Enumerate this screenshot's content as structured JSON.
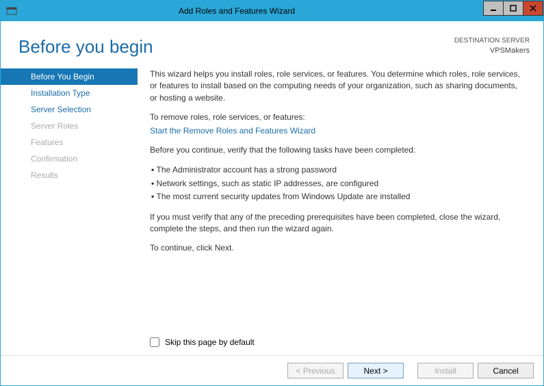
{
  "titlebar": {
    "title": "Add Roles and Features Wizard"
  },
  "header": {
    "title": "Before you begin",
    "dest_label": "DESTINATION SERVER",
    "dest_server": "VPSMakers"
  },
  "sidebar": {
    "items": [
      {
        "label": "Before You Begin",
        "state": "active"
      },
      {
        "label": "Installation Type",
        "state": "enabled"
      },
      {
        "label": "Server Selection",
        "state": "enabled"
      },
      {
        "label": "Server Roles",
        "state": "disabled"
      },
      {
        "label": "Features",
        "state": "disabled"
      },
      {
        "label": "Confirmation",
        "state": "disabled"
      },
      {
        "label": "Results",
        "state": "disabled"
      }
    ]
  },
  "content": {
    "intro": "This wizard helps you install roles, role services, or features. You determine which roles, role services, or features to install based on the computing needs of your organization, such as sharing documents, or hosting a website.",
    "remove_label": "To remove roles, role services, or features:",
    "remove_link": "Start the Remove Roles and Features Wizard",
    "verify_intro": "Before you continue, verify that the following tasks have been completed:",
    "bullets": [
      "The Administrator account has a strong password",
      "Network settings, such as static IP addresses, are configured",
      "The most current security updates from Windows Update are installed"
    ],
    "rerun": "If you must verify that any of the preceding prerequisites have been completed, close the wizard, complete the steps, and then run the wizard again.",
    "continue": "To continue, click Next.",
    "skip_label": "Skip this page by default"
  },
  "footer": {
    "previous": "< Previous",
    "next": "Next >",
    "install": "Install",
    "cancel": "Cancel"
  }
}
